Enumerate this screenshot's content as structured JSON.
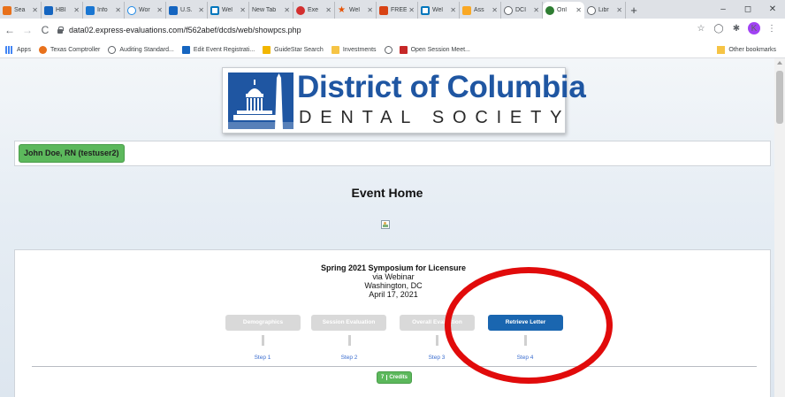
{
  "browser": {
    "tabs": [
      {
        "title": "Sea",
        "favicon": "bars-icon",
        "color": "#e8711c"
      },
      {
        "title": "HBI",
        "favicon": "h-icon",
        "color": "#1565c0"
      },
      {
        "title": "Info",
        "favicon": "info-icon",
        "color": "#1976d2"
      },
      {
        "title": "Wor",
        "favicon": "webex-icon",
        "color": "#1e88e5"
      },
      {
        "title": "U.S.",
        "favicon": "flag-icon",
        "color": "#1565c0"
      },
      {
        "title": "Wel",
        "favicon": "window-icon",
        "color": "#0277bd"
      },
      {
        "title": "New Tab",
        "favicon": "",
        "color": "#dee1e6"
      },
      {
        "title": "Exe",
        "favicon": "circle-icon",
        "color": "#d32f2f"
      },
      {
        "title": "Wel",
        "favicon": "star-icon",
        "color": "#e65100"
      },
      {
        "title": "FREE",
        "favicon": "c-icon",
        "color": "#d84315"
      },
      {
        "title": "Wel",
        "favicon": "window-icon",
        "color": "#0277bd"
      },
      {
        "title": "Ass",
        "favicon": "aae-icon",
        "color": "#f9a825"
      },
      {
        "title": "DCI",
        "favicon": "globe-icon",
        "color": "#5f6368"
      },
      {
        "title": "Onl",
        "favicon": "e-icon",
        "color": "#2e7d32",
        "active": true
      },
      {
        "title": "Libr",
        "favicon": "globe-icon",
        "color": "#5f6368"
      }
    ],
    "new_tab_symbol": "+",
    "window_controls": {
      "minimize": "–",
      "maximize": "◻",
      "close": "✕"
    },
    "url": "data02.express-evaluations.com/f562abef/dcds/web/showpcs.php",
    "profile_initial": "K",
    "bookmarks": [
      {
        "label": "Apps",
        "icon": "apps-grid-icon",
        "color": "#4285f4"
      },
      {
        "label": "Texas Comptroller",
        "icon": "texas-star-icon",
        "color": "#e8711c"
      },
      {
        "label": "Auditing Standard...",
        "icon": "globe-icon",
        "color": "#5f6368"
      },
      {
        "label": "Edit Event Registrati...",
        "icon": "h-icon",
        "color": "#1565c0"
      },
      {
        "label": "GuideStar Search",
        "icon": "guidestar-icon",
        "color": "#f2b600"
      },
      {
        "label": "Investments",
        "icon": "folder-icon",
        "color": "#f6c445"
      },
      {
        "label": "",
        "icon": "globe-icon",
        "color": "#5f6368"
      },
      {
        "label": "Open Session Meet...",
        "icon": "calendar-icon",
        "color": "#c62828"
      }
    ],
    "other_bookmarks": "Other bookmarks"
  },
  "page": {
    "logo_line1": "District of Columbia",
    "logo_line2": "DENTAL SOCIETY",
    "user_name": "John Doe, RN (testuser2)",
    "heading": "Event Home",
    "event": {
      "title": "Spring 2021 Symposium for Licensure",
      "mode": "via Webinar",
      "location": "Washington, DC",
      "date": "April 17, 2021"
    },
    "steps": [
      {
        "button": "Demographics",
        "label": "Step 1",
        "active": false
      },
      {
        "button": "Session Evaluation",
        "label": "Step 2",
        "active": false
      },
      {
        "button": "Overall Evaluation",
        "label": "Step 3",
        "active": false
      },
      {
        "button": "Retrieve Letter",
        "label": "Step 4",
        "active": true
      }
    ],
    "credits_value": "7",
    "credits_label": "Credits"
  },
  "colors": {
    "brand_blue": "#1f56a2",
    "active_button": "#1a66b0",
    "disabled_button": "#d9d9d9",
    "success_green": "#5cb85c",
    "annotation_red": "#e10b0b"
  }
}
